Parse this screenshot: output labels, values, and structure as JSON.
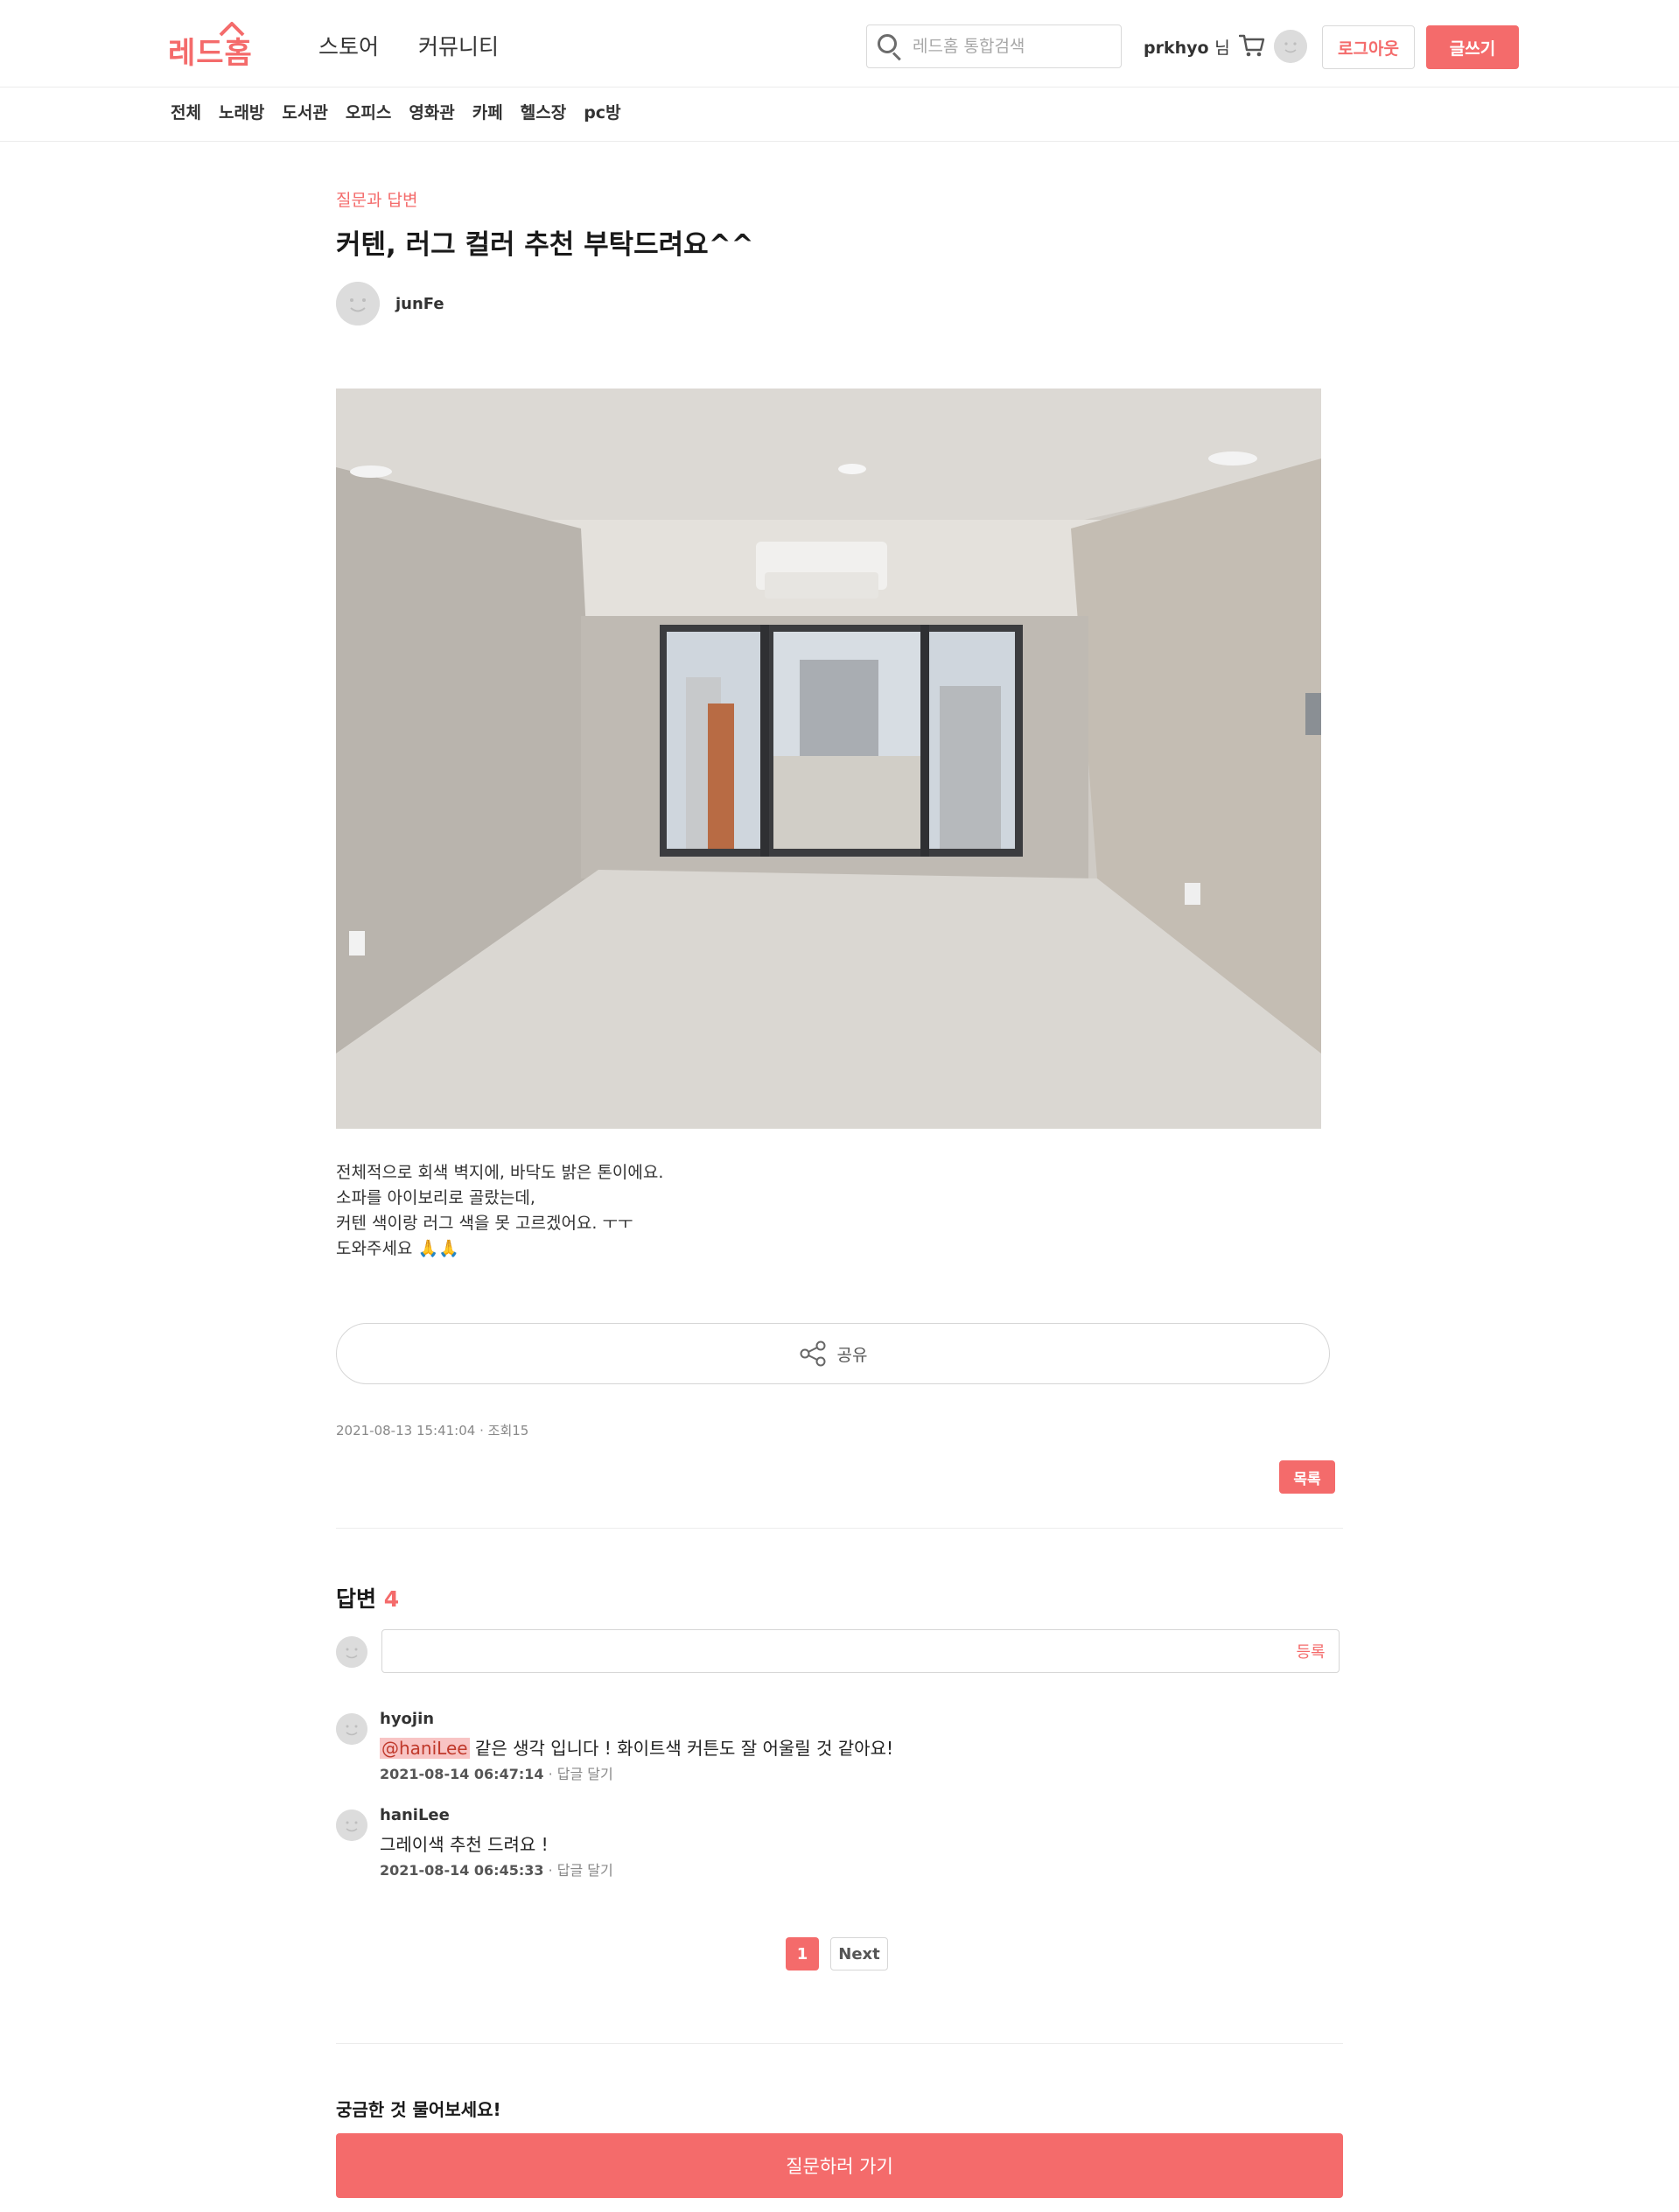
{
  "header": {
    "logo": "레드홈",
    "nav": [
      "스토어",
      "커뮤니티"
    ],
    "search_placeholder": "레드홈 통합검색",
    "user_name": "prkhyo",
    "user_suffix": "님",
    "logout_label": "로그아웃",
    "write_label": "글쓰기"
  },
  "subnav": [
    "전체",
    "노래방",
    "도서관",
    "오피스",
    "영화관",
    "카페",
    "헬스장",
    "pc방"
  ],
  "post": {
    "category": "질문과 답변",
    "title": "커텐, 러그 컬러 추천 부탁드려요^^",
    "author": "junFe",
    "body": [
      "전체적으로 회색 벽지에, 바닥도 밝은 톤이에요.",
      "소파를 아이보리로 골랐는데,",
      "커텐 색이랑 러그 색을 못 고르겠어요. ㅜㅜ",
      "도와주세요 🙏🙏"
    ],
    "share_label": "공유",
    "date": "2021-08-13 15:41:04",
    "views": "조회15",
    "list_label": "목록"
  },
  "answers": {
    "title": "답변",
    "count": "4",
    "reply_placeholder": "",
    "submit_label": "등록",
    "comments": [
      {
        "name": "hyojin",
        "mention": "@haniLee",
        "text": " 같은 생각 입니다 ! 화이트색 커튼도 잘 어울릴 것 같아요!",
        "date": "2021-08-14 06:47:14",
        "actions": "· 답글 달기"
      },
      {
        "name": "haniLee",
        "mention": "",
        "text": "그레이색 추천 드려요 !",
        "date": "2021-08-14 06:45:33",
        "actions": "· 답글 달기"
      }
    ]
  },
  "pagination": {
    "current": "1",
    "next_label": "Next"
  },
  "ask": {
    "title": "궁금한 것 물어보세요!",
    "button_label": "질문하러 가기"
  },
  "colors": {
    "accent": "#f46b6b"
  }
}
